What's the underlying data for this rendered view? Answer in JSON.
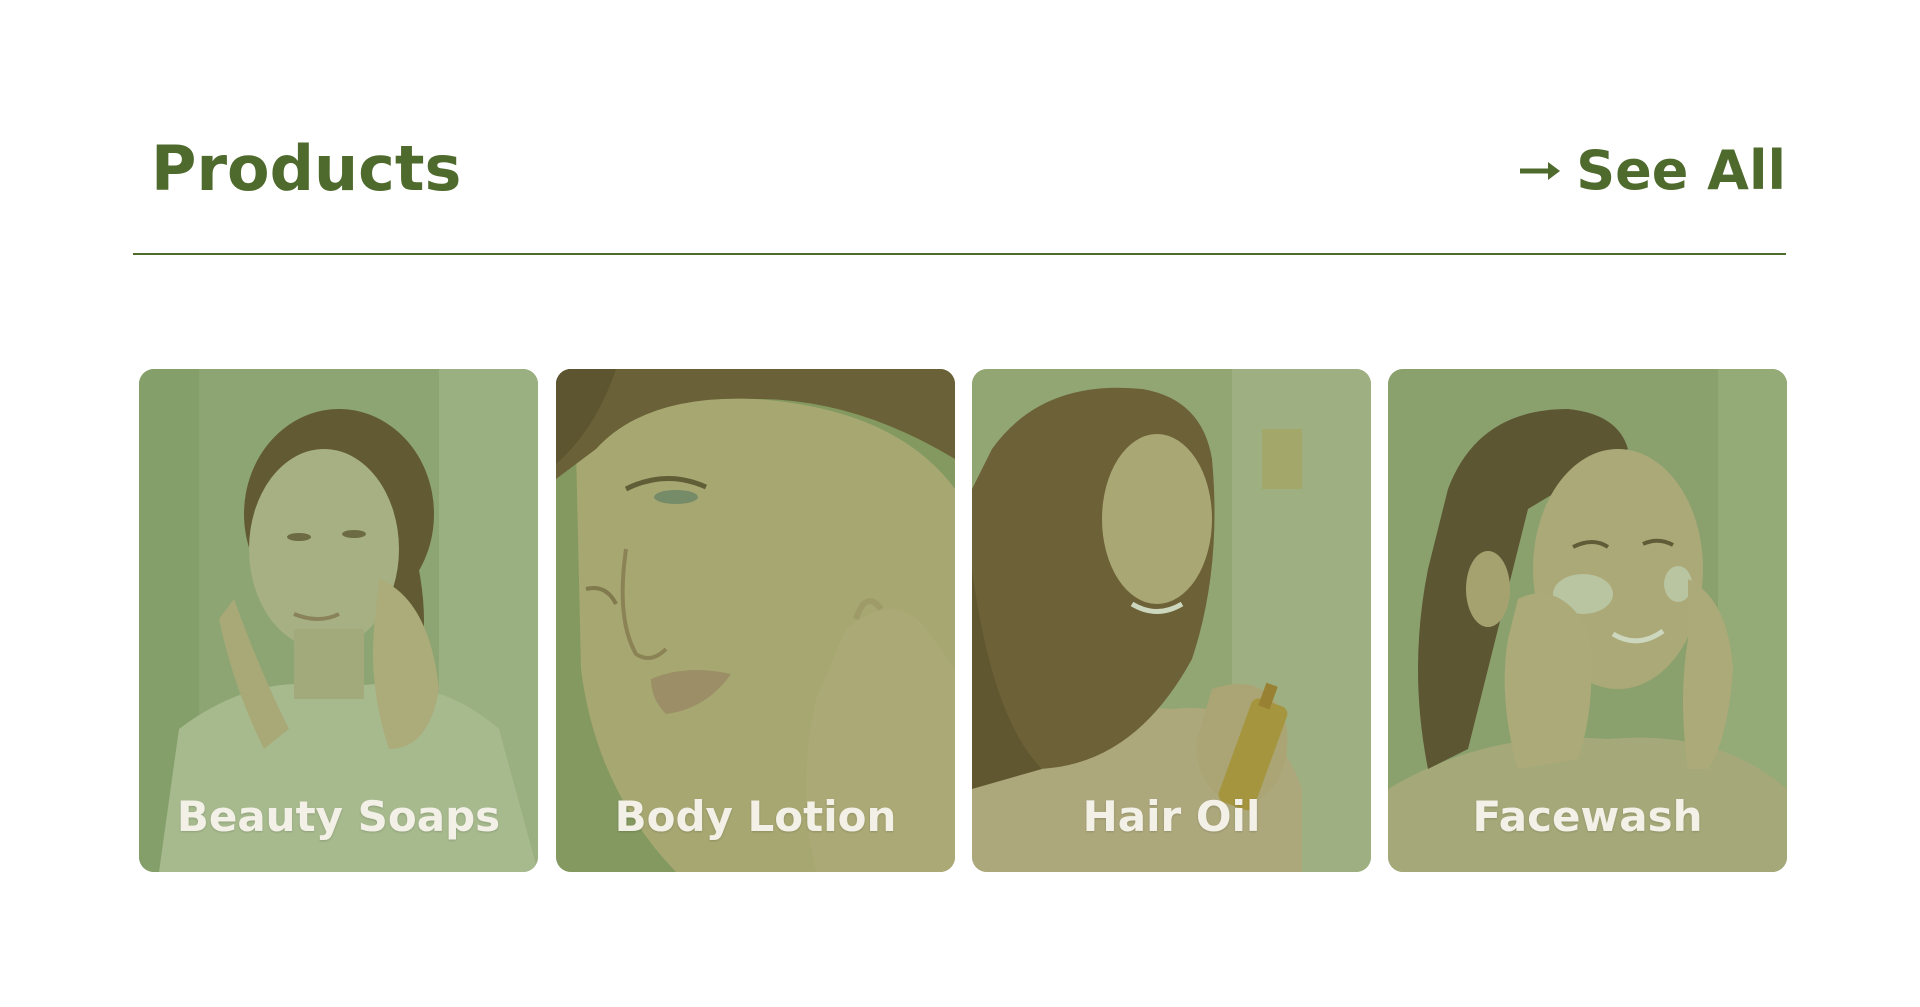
{
  "section": {
    "title": "Products",
    "see_all_label": "See All",
    "arrow_icon": "arrow-right-icon"
  },
  "colors": {
    "accent": "#4f6a2d",
    "card_label": "#f3f1e7",
    "background": "#ffffff"
  },
  "products": [
    {
      "label": "Beauty Soaps",
      "image": "woman-washing-face-photo"
    },
    {
      "label": "Body Lotion",
      "image": "woman-skin-closeup-photo"
    },
    {
      "label": "Hair Oil",
      "image": "woman-applying-hair-oil-photo"
    },
    {
      "label": "Facewash",
      "image": "woman-cleansing-face-photo"
    }
  ]
}
